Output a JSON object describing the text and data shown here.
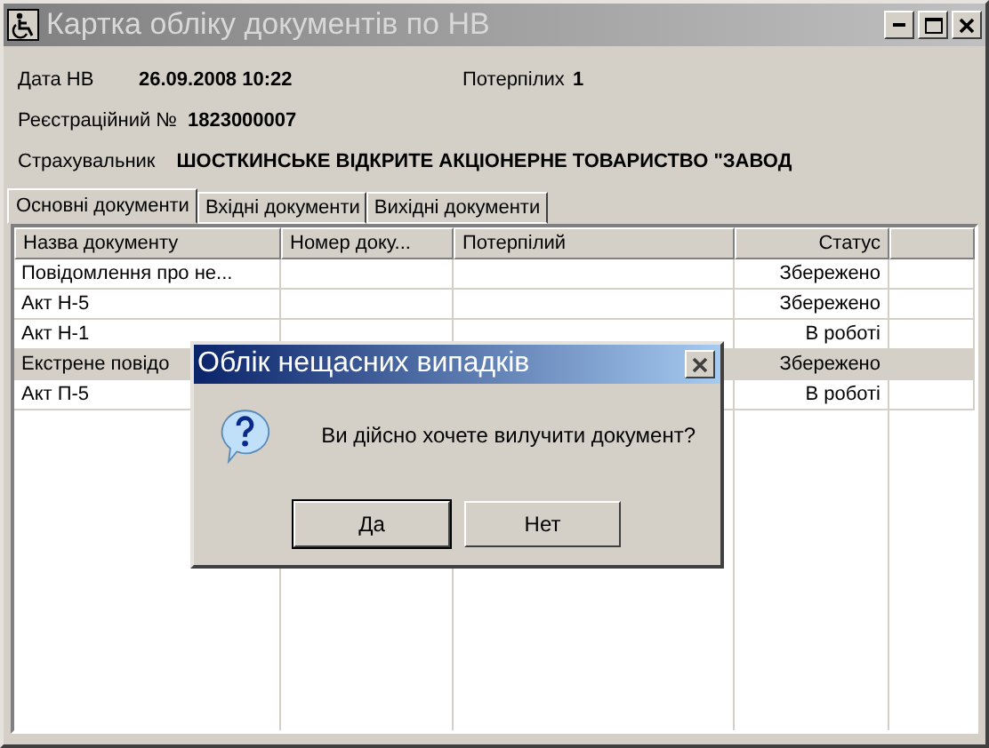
{
  "window": {
    "title": "Картка обліку документів по НВ"
  },
  "fields": [
    {
      "label": "Дата НВ",
      "value": "26.09.2008 10:22"
    },
    {
      "label": "Потерпілих",
      "value": "1"
    },
    {
      "label": "Реєстраційний №",
      "value": "1823000007"
    },
    {
      "label": "Страхувальник",
      "value": "ШОСТКИНСЬКЕ ВІДКРИТЕ АКЦІОНЕРНЕ ТОВАРИСТВО \"ЗАВОД"
    }
  ],
  "tabs": [
    {
      "label": "Основні документи",
      "selected": true
    },
    {
      "label": "Вхідні документи",
      "selected": false
    },
    {
      "label": "Вихідні документи",
      "selected": false
    }
  ],
  "table": {
    "columns": [
      "Назва документу",
      "Номер доку...",
      "Потерпілий",
      "Статус"
    ],
    "rows": [
      {
        "cells": [
          "Повідомлення про не...",
          "",
          "",
          "Збережено"
        ],
        "selected": false
      },
      {
        "cells": [
          "Акт Н-5",
          "",
          "",
          "Збережено"
        ],
        "selected": false
      },
      {
        "cells": [
          "Акт Н-1",
          "",
          "",
          "В роботі"
        ],
        "selected": false
      },
      {
        "cells": [
          "Екстрене повідо",
          "",
          "",
          "Збережено"
        ],
        "selected": true
      },
      {
        "cells": [
          "Акт П-5",
          "",
          "",
          "В роботі"
        ],
        "selected": false
      }
    ]
  },
  "dialog": {
    "title": "Облік нещасних випадків",
    "message": "Ви дійсно хочете вилучити документ?",
    "buttons": [
      {
        "label": "Да",
        "selected": true
      },
      {
        "label": "Нет",
        "selected": false
      }
    ]
  }
}
